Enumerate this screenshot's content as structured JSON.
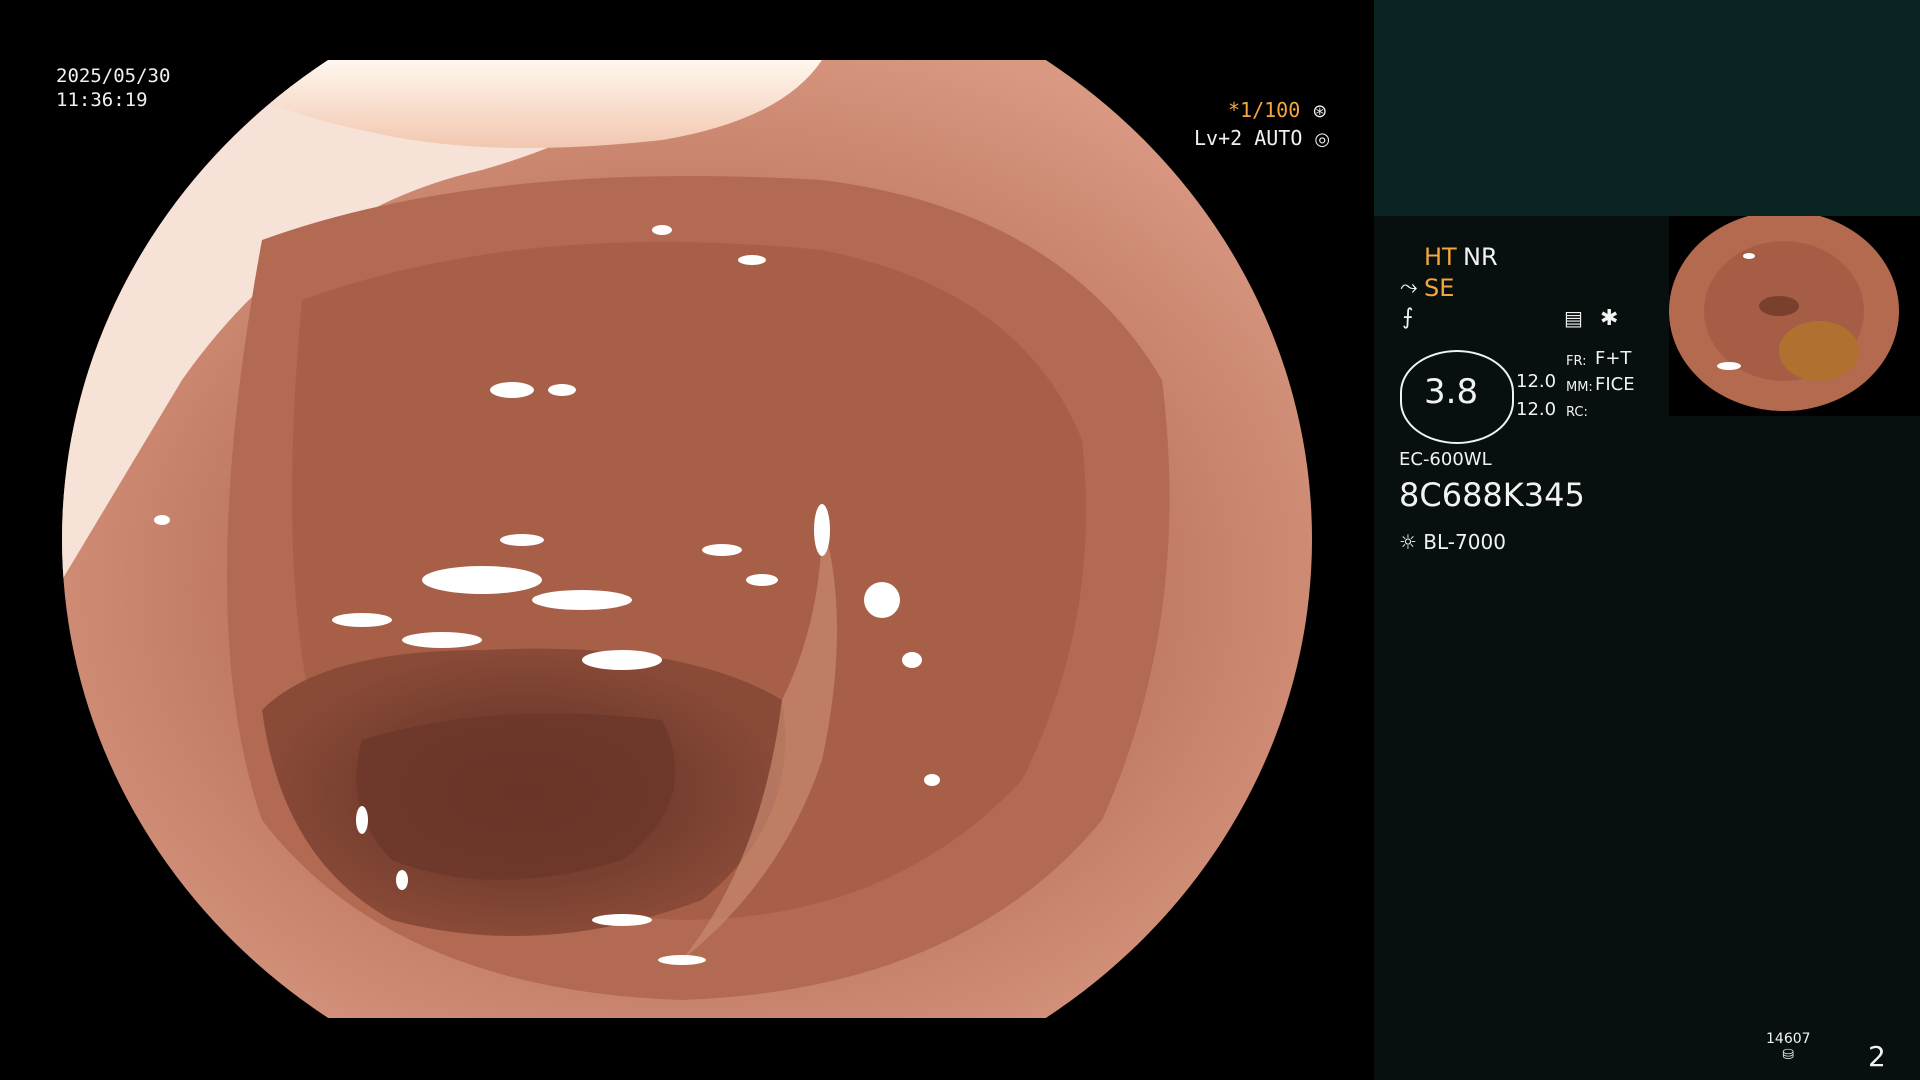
{
  "overlay": {
    "date": "2025/05/30",
    "time": "11:36:19",
    "shutter": "*1/100",
    "level": "Lv+2 AUTO"
  },
  "panel": {
    "ht": "HT",
    "nr": "NR",
    "se": "SE",
    "zoom_value": "3.8",
    "fr_label": "FR:",
    "fr_value": "F+T",
    "mm_label": "MM:",
    "mm_value": "FICE",
    "rc_label": "RC:",
    "row1_value": "12.0",
    "row2_value": "12.0",
    "scope_model": "EC-600WL",
    "serial": "8C688K345",
    "light_source": "BL-7000",
    "counter": "14607",
    "page": "2"
  },
  "icons": {
    "shutter_icon": "aperture-icon",
    "auto_icon": "auto-iris-icon",
    "se_icon": "structure-enhance-icon",
    "freeze_icon": "freeze-icon",
    "menu_icon": "menu-icon",
    "star_icon": "star-icon",
    "light_icon": "sun-icon",
    "storage_icon": "database-icon"
  },
  "colors": {
    "accent": "#f3a640",
    "panel_bg": "#07100f",
    "panel_top": "#0a2424",
    "tissue": "#b86e58"
  }
}
